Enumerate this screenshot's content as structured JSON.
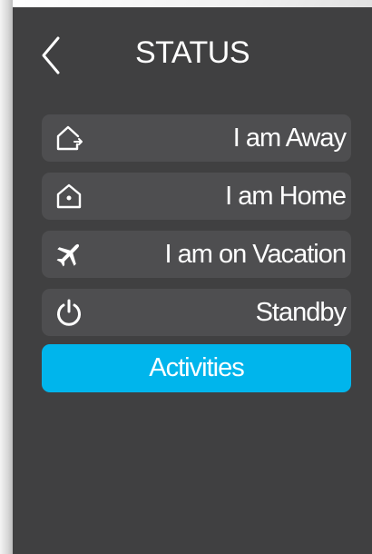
{
  "header": {
    "title": "STATUS",
    "back_icon": "chevron-left-icon"
  },
  "status_options": [
    {
      "label": "I am Away",
      "icon": "house-exit-icon"
    },
    {
      "label": "I am Home",
      "icon": "house-icon"
    },
    {
      "label": "I am on Vacation",
      "icon": "airplane-icon"
    },
    {
      "label": "Standby",
      "icon": "power-icon"
    }
  ],
  "activities": {
    "label": "Activities"
  },
  "colors": {
    "panel_background": "#404041",
    "item_background": "#4e4e50",
    "accent": "#00b5ec",
    "text": "#ffffff"
  }
}
